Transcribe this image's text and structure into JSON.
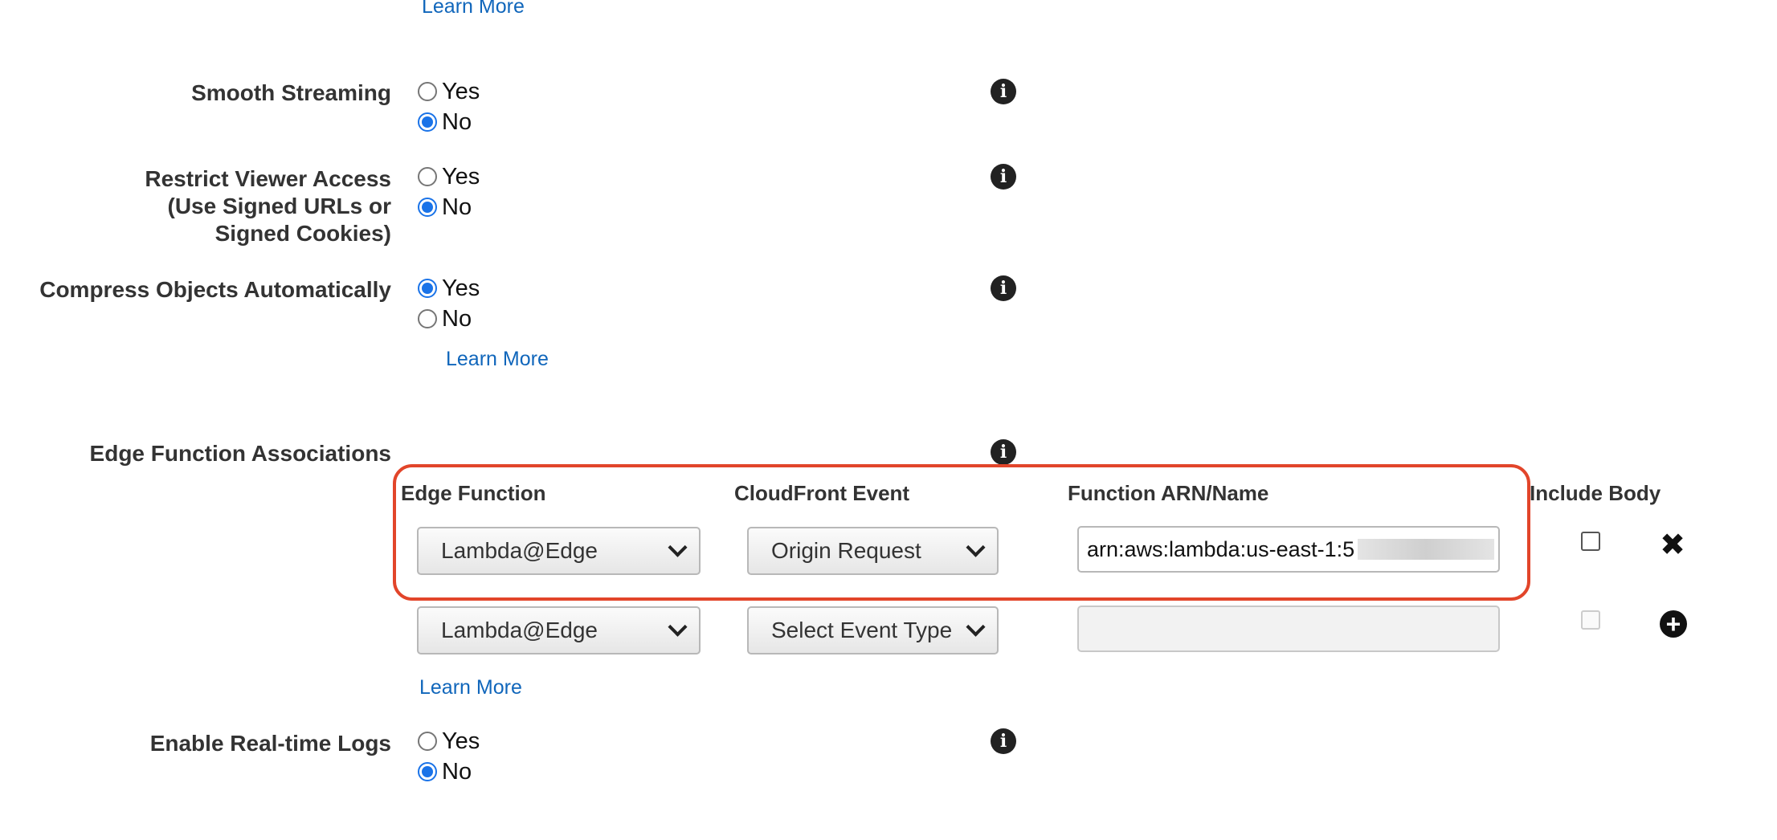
{
  "top_link": "Learn More",
  "fields": {
    "smooth_streaming": {
      "label": "Smooth Streaming",
      "options": [
        "Yes",
        "No"
      ],
      "selected": "No"
    },
    "restrict_viewer_access": {
      "label_lines": [
        "Restrict Viewer Access",
        "(Use Signed URLs or",
        "Signed Cookies)"
      ],
      "options": [
        "Yes",
        "No"
      ],
      "selected": "No"
    },
    "compress_objects": {
      "label": "Compress Objects Automatically",
      "options": [
        "Yes",
        "No"
      ],
      "selected": "Yes",
      "link": "Learn More"
    },
    "edge_function_associations": {
      "label": "Edge Function Associations",
      "columns": [
        "Edge Function",
        "CloudFront Event",
        "Function ARN/Name",
        "Include Body"
      ],
      "rows": [
        {
          "edge_function": "Lambda@Edge",
          "event": "Origin Request",
          "arn": "arn:aws:lambda:us-east-1:5",
          "include_body": false,
          "action_icon": "remove-icon"
        },
        {
          "edge_function": "Lambda@Edge",
          "event": "Select Event Type",
          "arn": "",
          "include_body": false,
          "action_icon": "add-icon"
        }
      ],
      "link": "Learn More"
    },
    "realtime_logs": {
      "label": "Enable Real-time Logs",
      "options": [
        "Yes",
        "No"
      ],
      "selected": "No"
    }
  },
  "colors": {
    "link": "#1066bb",
    "radio_checked": "#1a73e8",
    "highlight_border": "#e2452a"
  }
}
